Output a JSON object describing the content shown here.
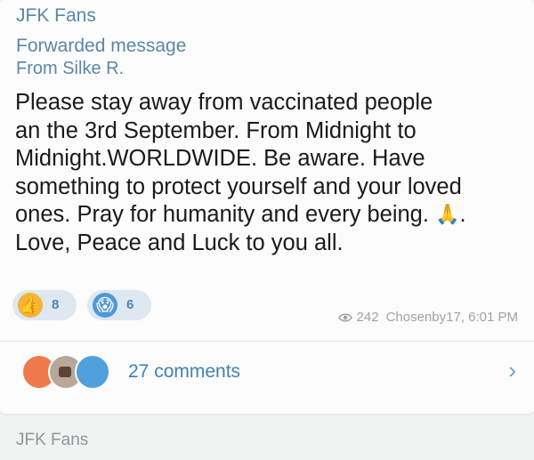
{
  "post": {
    "channel_name": "JFK Fans",
    "forwarded_label": "Forwarded message",
    "forwarded_from": "From Silke R.",
    "body_lines": [
      "Please stay away from vaccinated people",
      "an the 3rd September. From Midnight to",
      "Midnight.WORLDWIDE. Be aware. Have",
      "something to protect yourself and your loved",
      "ones. Pray for humanity and every being.",
      "Love, Peace and Luck to you all."
    ],
    "body_emoji": "🙏",
    "body_after_emoji": ".",
    "reactions": [
      {
        "icon": "thumbs-up-icon",
        "glyph": "👍",
        "count": "8"
      },
      {
        "icon": "scream-face-icon",
        "glyph": "😱",
        "count": "6"
      }
    ],
    "views": "242",
    "author_time": "Chosenby17, 6:01 PM",
    "comments_label": "27 comments"
  },
  "footer": {
    "channel_name": "JFK Fans"
  },
  "colors": {
    "accent": "#5d86a6",
    "link": "#3f82b9",
    "meta": "#9ea4a8"
  }
}
